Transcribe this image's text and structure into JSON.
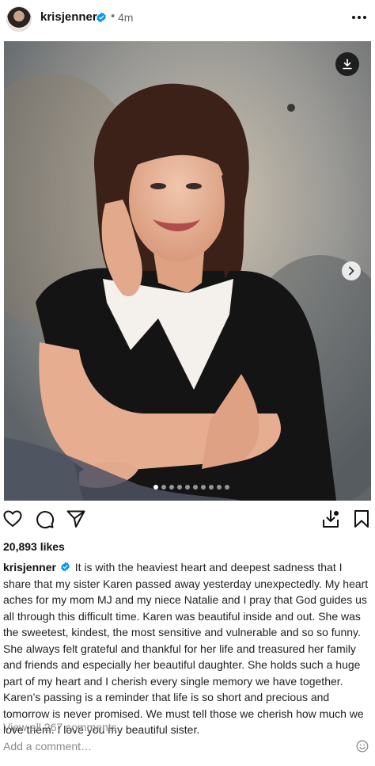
{
  "header": {
    "username": "krisjenner",
    "separator": "•",
    "time_ago": "4m"
  },
  "carousel": {
    "total_slides": 10,
    "current_slide": 1
  },
  "post": {
    "likes": "20,893 likes",
    "caption_user": "krisjenner",
    "caption_text": "It is with the heaviest heart and deepest sadness that I share that my sister Karen passed away yesterday unexpectedly. My heart aches for my mom MJ and my niece Natalie and I pray that God guides us all through this difficult time. Karen was beautiful inside and out. She was the sweetest, kindest, the most sensitive and vulnerable and so so funny. She always felt grateful and thankful for her life and treasured her family and friends and especially her beautiful daughter. She holds such a huge part of my heart and I cherish every single memory we have together. Karen’s passing is a reminder that life is so short and precious and tomorrow is never promised. We must tell those we cherish how much we love them. I love you my beautiful sister.",
    "view_comments": "View all 267 comments",
    "add_comment_placeholder": "Add a comment…"
  },
  "icons": {
    "verified": "verified-badge-icon",
    "more": "more-horizontal-icon",
    "download": "download-icon",
    "next": "chevron-right-icon",
    "like": "heart-icon",
    "comment": "comment-icon",
    "share": "share-icon",
    "save_download": "save-to-device-icon",
    "bookmark": "bookmark-icon",
    "emoji": "emoji-icon"
  },
  "colors": {
    "verified_blue": "#0095f6",
    "muted_text": "#8a8a8a"
  }
}
